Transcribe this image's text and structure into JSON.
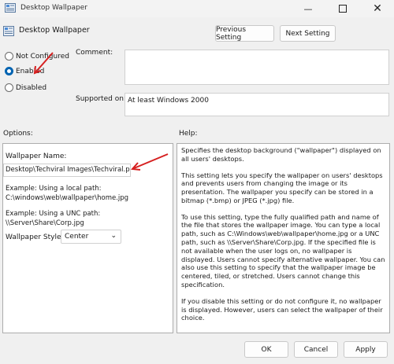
{
  "window": {
    "title": "Desktop Wallpaper"
  },
  "header": {
    "title": "Desktop Wallpaper",
    "prev_label": "Previous Setting",
    "next_label": "Next Setting"
  },
  "state": {
    "not_configured": "Not Configured",
    "enabled": "Enabled",
    "disabled": "Disabled",
    "selected": "Enabled"
  },
  "comment": {
    "label": "Comment:",
    "value": ""
  },
  "supported": {
    "label": "Supported on:",
    "value": "At least Windows 2000"
  },
  "options": {
    "heading": "Options:",
    "wallpaper_name_label": "Wallpaper Name:",
    "wallpaper_name_value": "Desktop\\Techviral Images\\Techviral.png\"",
    "local_example_label": "Example: Using a local path:",
    "local_example_value": "C:\\windows\\web\\wallpaper\\home.jpg",
    "unc_example_label": "Example: Using a UNC path:",
    "unc_example_value": "\\\\Server\\Share\\Corp.jpg",
    "style_label": "Wallpaper Style:",
    "style_value": "Center"
  },
  "help": {
    "heading": "Help:",
    "p1": "Specifies the desktop background (\"wallpaper\") displayed on all users' desktops.",
    "p2": "This setting lets you specify the wallpaper on users' desktops and prevents users from changing the image or its presentation. The wallpaper you specify can be stored in a bitmap (*.bmp) or JPEG (*.jpg) file.",
    "p3": "To use this setting, type the fully qualified path and name of the file that stores the wallpaper image. You can type a local path, such as C:\\Windows\\web\\wallpaper\\home.jpg or a UNC path, such as \\\\Server\\Share\\Corp.jpg. If the specified file is not available when the user logs on, no wallpaper is displayed. Users cannot specify alternative wallpaper. You can also use this setting to specify that the wallpaper image be centered, tiled, or stretched. Users cannot change this specification.",
    "p4": "If you disable this setting or do not configure it, no wallpaper is displayed. However, users can select the wallpaper of their choice."
  },
  "footer": {
    "ok_label": "OK",
    "cancel_label": "Cancel",
    "apply_label": "Apply"
  },
  "colors": {
    "accent": "#0063b1",
    "arrow": "#d62020"
  }
}
